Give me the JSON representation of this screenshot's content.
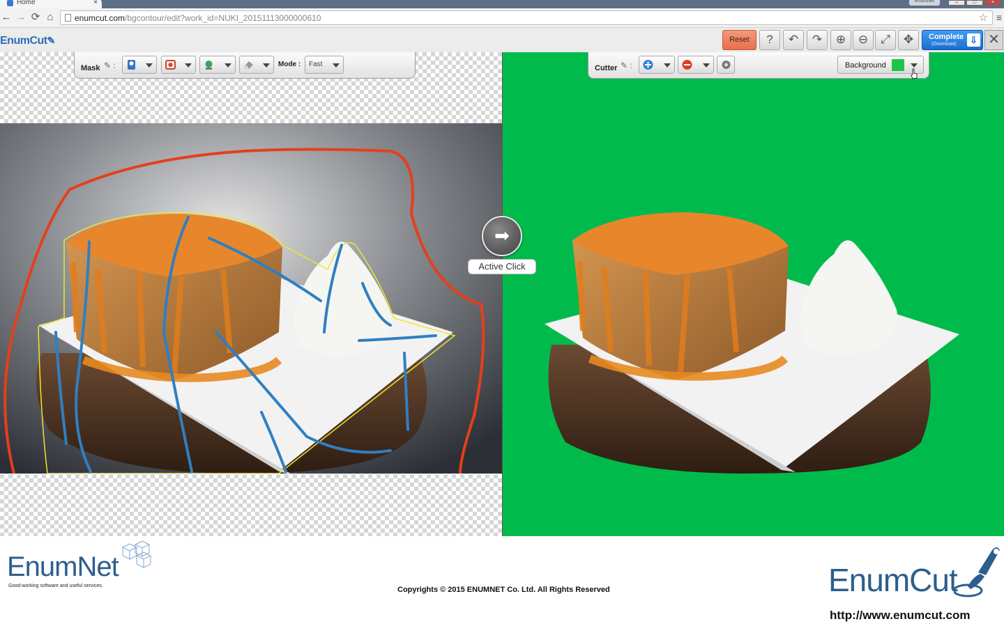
{
  "browser": {
    "tab_title": "Home",
    "tab_close": "×",
    "profile": "Enumnet",
    "url_host": "enumcut.com",
    "url_path": "/bgcontour/edit?work_id=NUKI_20151113000000610"
  },
  "app": {
    "logo_text": "EnumCut",
    "reset_label": "Reset",
    "complete_label": "Complete",
    "complete_sub": "(Download)",
    "header_icons": [
      "help-icon",
      "undo-icon",
      "redo-icon",
      "zoom-in-icon",
      "zoom-out-icon",
      "fit-screen-icon",
      "move-icon"
    ],
    "help_glyph": "?",
    "undo_glyph": "↶",
    "redo_glyph": "↷",
    "zoom_in_glyph": "⊕",
    "zoom_out_glyph": "⊖",
    "fit_glyph": "⤢",
    "move_glyph": "✥",
    "close_glyph": "✕"
  },
  "mask_bar": {
    "label": "Mask",
    "tools": [
      "foreground-brush",
      "background-brush",
      "contour-brush",
      "eraser"
    ],
    "mode_label": "Mode :",
    "mode_value": "Fast"
  },
  "cutter_bar": {
    "label": "Cutter",
    "tools": [
      "add-icon",
      "subtract-icon",
      "settings-icon"
    ],
    "background_label": "Background",
    "background_color": "#1fc447"
  },
  "canvas": {
    "active_click_label": "Active Click",
    "right_background": "#00bb4b",
    "stroke_red": "#e2401c",
    "stroke_blue": "#2f7fc2",
    "outline_yellow": "#f0e530"
  },
  "footer": {
    "left_logo": "EnumNet",
    "tagline": "Good-working  software and  useful services.",
    "copyright": "Copyrights © 2015 ENUMNET Co. Ltd. All Rights Reserved",
    "right_logo": "EnumCut",
    "url": "http://www.enumcut.com"
  }
}
